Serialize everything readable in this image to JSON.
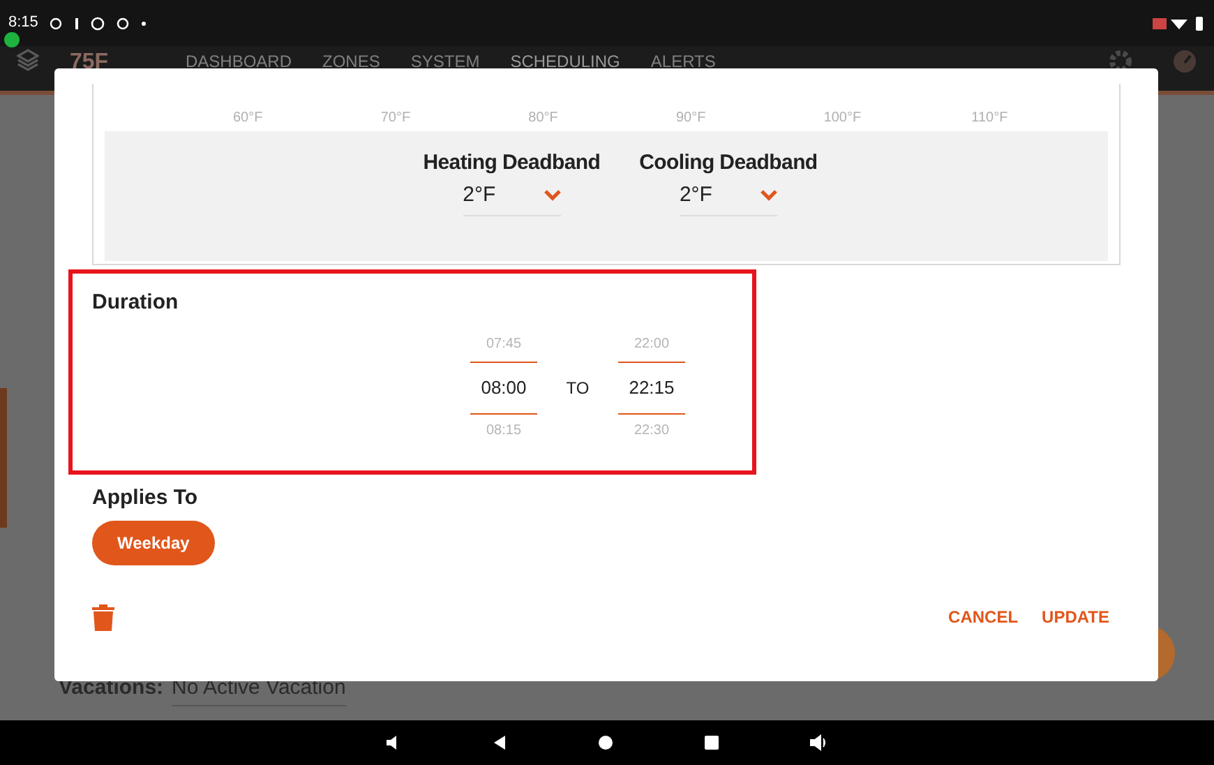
{
  "status_bar": {
    "time": "8:15"
  },
  "app_header": {
    "logo": "75F",
    "nav": [
      {
        "label": "DASHBOARD",
        "selected": false
      },
      {
        "label": "ZONES",
        "selected": false
      },
      {
        "label": "SYSTEM",
        "selected": false
      },
      {
        "label": "SCHEDULING",
        "selected": true
      },
      {
        "label": "ALERTS",
        "selected": false
      }
    ]
  },
  "background": {
    "vacations_label": "Vacations:",
    "vacations_value": "No Active Vacation"
  },
  "dialog": {
    "slider_ticks": [
      "60°F",
      "70°F",
      "80°F",
      "90°F",
      "100°F",
      "110°F"
    ],
    "deadbands": [
      {
        "label": "Heating Deadband",
        "value": "2°F"
      },
      {
        "label": "Cooling Deadband",
        "value": "2°F"
      }
    ],
    "duration": {
      "title": "Duration",
      "highlighted": true,
      "start": {
        "above": "07:45",
        "value": "08:00",
        "below": "08:15"
      },
      "separator": "TO",
      "end": {
        "above": "22:00",
        "value": "22:15",
        "below": "22:30"
      }
    },
    "applies_to": {
      "title": "Applies To",
      "chips": [
        {
          "label": "Weekday",
          "selected": true
        }
      ]
    },
    "actions": [
      "CANCEL",
      "UPDATE"
    ]
  }
}
